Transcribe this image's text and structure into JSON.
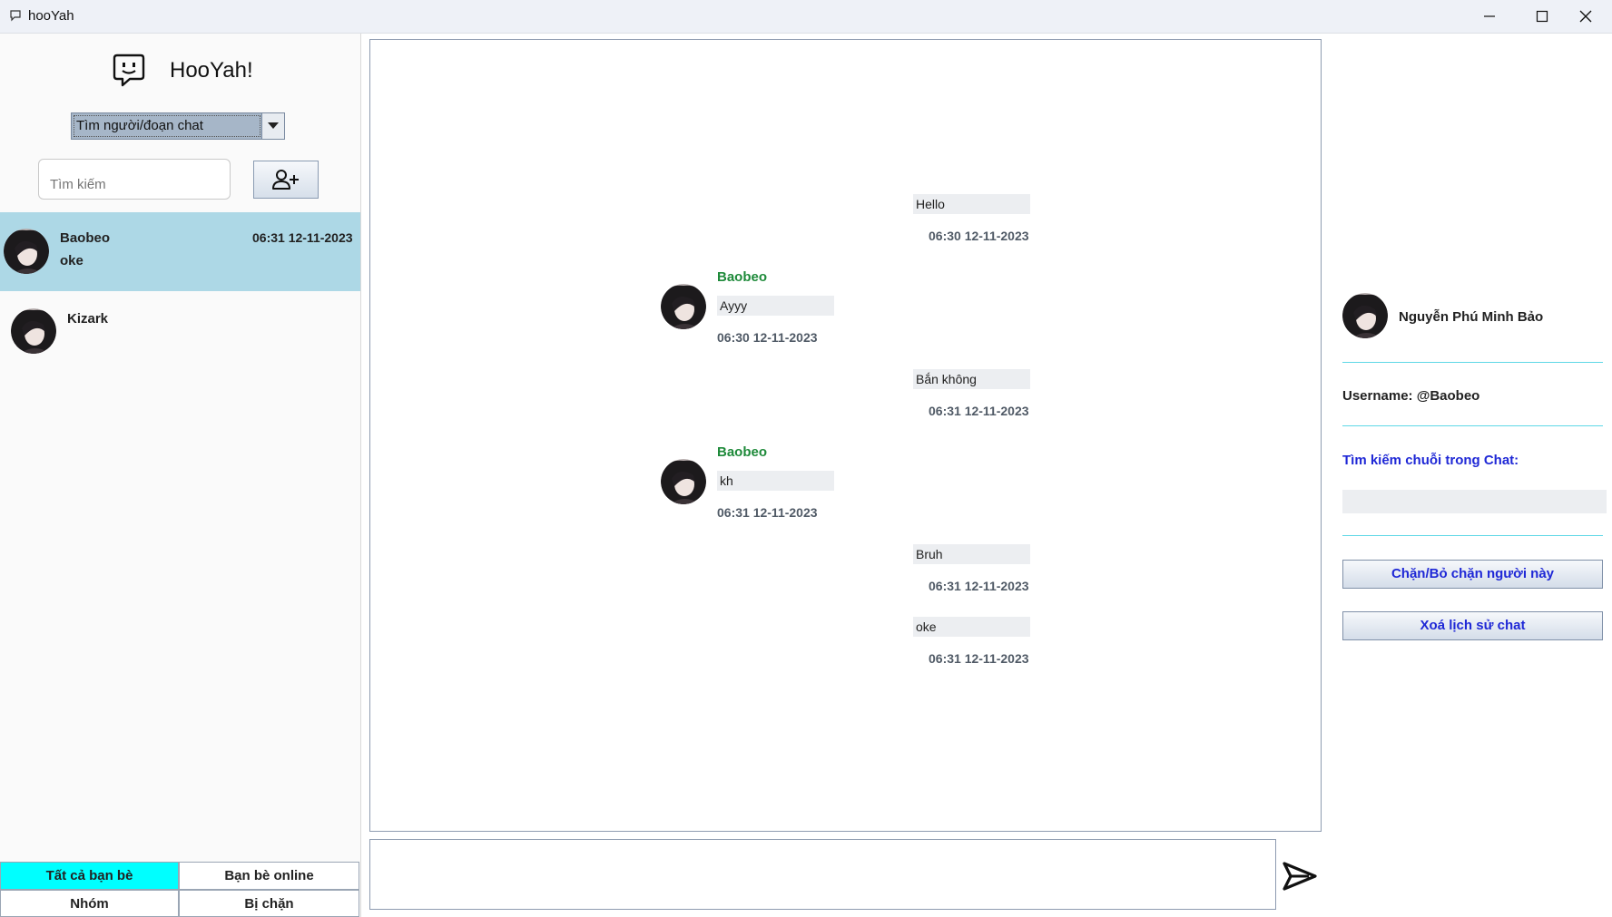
{
  "window": {
    "title": "hooYah"
  },
  "sidebar": {
    "logo_text": "HooYah!",
    "mode_select": {
      "value": "Tìm người/đoạn chat"
    },
    "search": {
      "placeholder": "Tìm kiếm"
    },
    "conversations": [
      {
        "name": "Baobeo",
        "time": "06:31 12-11-2023",
        "last_message": "oke",
        "selected": true
      },
      {
        "name": "Kizark",
        "time": "",
        "last_message": "",
        "selected": false
      }
    ],
    "filters": {
      "all_friends": "Tất cả bạn bè",
      "online_friends": "Bạn bè online",
      "groups": "Nhóm",
      "blocked": "Bị chặn"
    },
    "active_filter_color": "#00ffff",
    "selected_row_color": "#add8e6"
  },
  "chat": {
    "messages": [
      {
        "from": "me",
        "text": "Hello",
        "time": "06:30 12-11-2023"
      },
      {
        "from": "other",
        "sender": "Baobeo",
        "text": "Ayyy",
        "time": "06:30 12-11-2023"
      },
      {
        "from": "me",
        "text": "Bắn không",
        "time": "06:31 12-11-2023"
      },
      {
        "from": "other",
        "sender": "Baobeo",
        "text": "kh",
        "time": "06:31 12-11-2023"
      },
      {
        "from": "me",
        "text": "Bruh",
        "time": "06:31 12-11-2023"
      },
      {
        "from": "me",
        "text": "oke",
        "time": "06:31 12-11-2023"
      }
    ],
    "compose": {
      "value": ""
    },
    "sender_color": "#1e8a3a"
  },
  "profile": {
    "full_name": "Nguyễn Phú Minh Bảo",
    "username_line": "Username: @Baobeo",
    "search_label": "Tìm kiếm chuỗi trong Chat:",
    "search_value": "",
    "block_button": "Chặn/Bỏ chặn người này",
    "clear_history_button": "Xoá lịch sử chat",
    "accent_color": "#1f28d6",
    "divider_color": "#5fd8e6"
  },
  "icons": {
    "app": "chat-bubble-icon",
    "logo": "chat-bubble-face-icon",
    "add_friend": "add-user-icon",
    "send": "send-icon",
    "dropdown": "chevron-down-icon"
  }
}
